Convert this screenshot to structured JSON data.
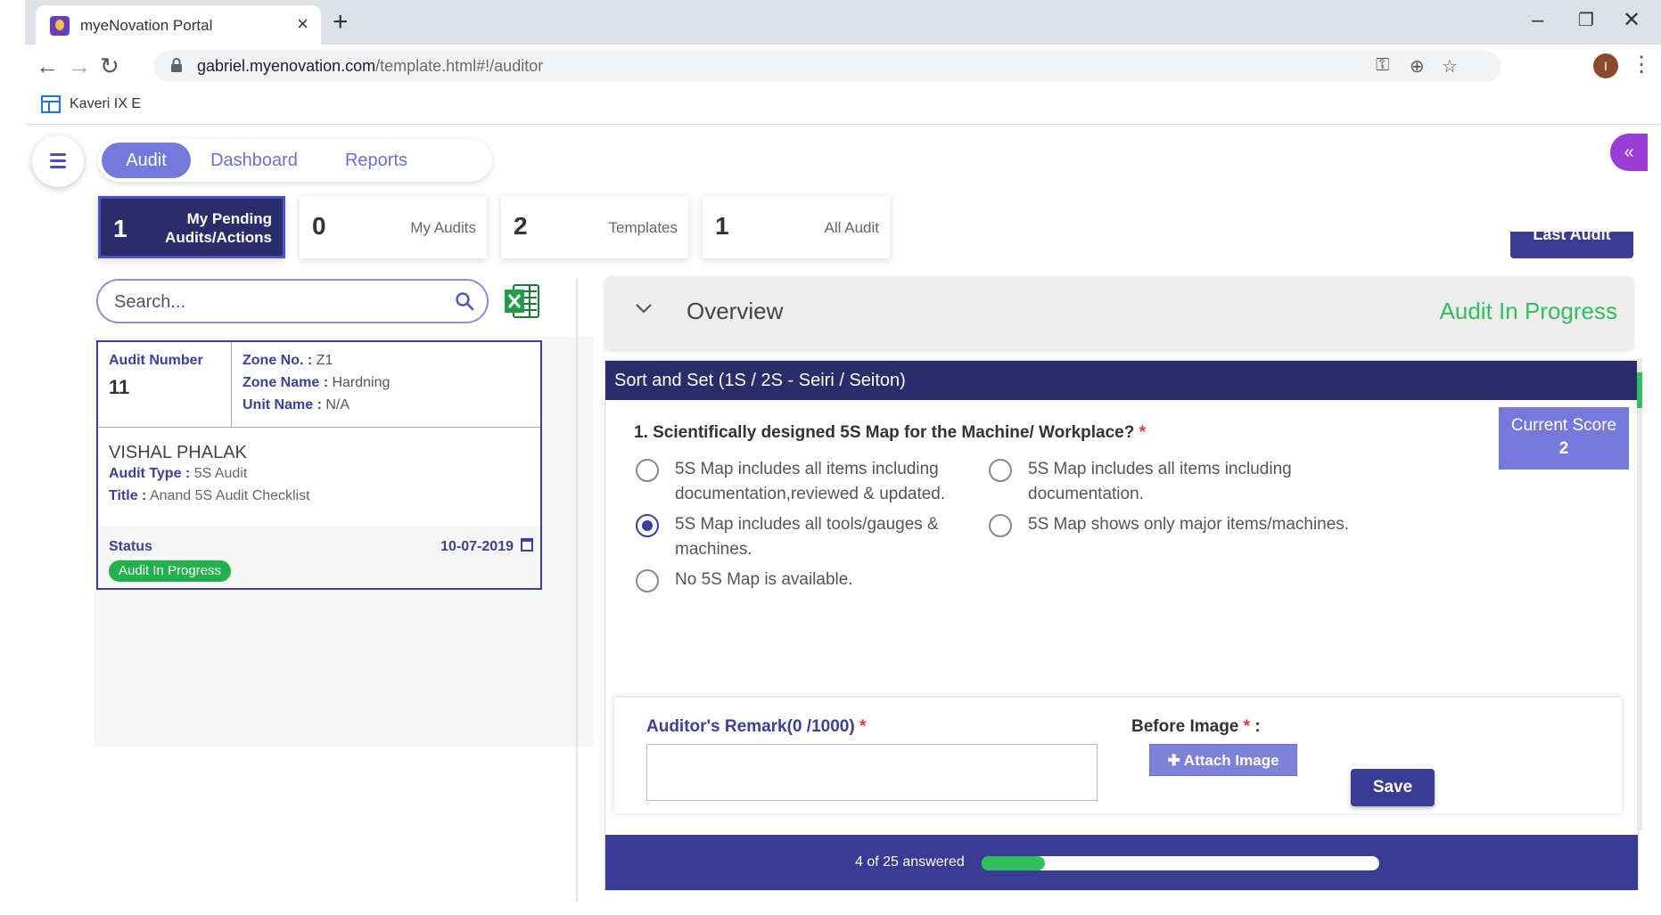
{
  "browser": {
    "tab_title": "myeNovation Portal",
    "url_host": "gabriel.myenovation.com",
    "url_path": "/template.html#!/auditor",
    "bookmark": "Kaveri IX E",
    "profile_initial": "I"
  },
  "nav": {
    "tabs": [
      "Audit",
      "Dashboard",
      "Reports"
    ],
    "active": "Audit"
  },
  "stats": [
    {
      "count": "1",
      "label_line1": "My Pending",
      "label_line2": "Audits/Actions"
    },
    {
      "count": "0",
      "label": "My Audits"
    },
    {
      "count": "2",
      "label": "Templates"
    },
    {
      "count": "1",
      "label": "All Audit"
    }
  ],
  "search": {
    "placeholder": "Search..."
  },
  "audit_card": {
    "number_label": "Audit Number",
    "number": "11",
    "zone_no_label": "Zone No. :",
    "zone_no": " Z1",
    "zone_name_label": "Zone Name :",
    "zone_name": " Hardning",
    "unit_name_label": "Unit Name :",
    "unit_name": " N/A",
    "auditor": "VISHAL PHALAK",
    "audit_type_label": "Audit Type :",
    "audit_type": " 5S Audit",
    "title_label": "Title :",
    "title": " Anand 5S Audit Checklist",
    "status_label": "Status",
    "date": "10-07-2019",
    "status": "Audit In Progress"
  },
  "overview": {
    "last_audit_label": "Last Audit",
    "title": "Overview",
    "status": "Audit In Progress"
  },
  "section": {
    "header": "Sort and Set (1S / 2S - Seiri / Seiton)",
    "score_label": "Current Score",
    "score": "2",
    "question": "1. Scientifically designed 5S Map for the Machine/ Workplace?",
    "required_mark": "*",
    "options": [
      {
        "text": "5S Map includes all items including documentation,reviewed & updated.",
        "checked": false
      },
      {
        "text": "5S Map includes all items including documentation.",
        "checked": false
      },
      {
        "text": "5S Map includes all tools/gauges & machines.",
        "checked": true
      },
      {
        "text": "5S Map shows only major items/machines.",
        "checked": false
      },
      {
        "text": "No 5S Map is available.",
        "checked": false
      }
    ],
    "remark_label": "Auditor's Remark(0 /1000)",
    "before_image_label": "Before Image",
    "before_image_suffix": " :",
    "attach_label": "Attach Image",
    "save_label": "Save"
  },
  "progress": {
    "text": "4 of 25 answered",
    "answered": 4,
    "total": 25
  },
  "colors": {
    "primary": "#393c92",
    "accent": "#7579db",
    "success": "#2fbf5d"
  }
}
